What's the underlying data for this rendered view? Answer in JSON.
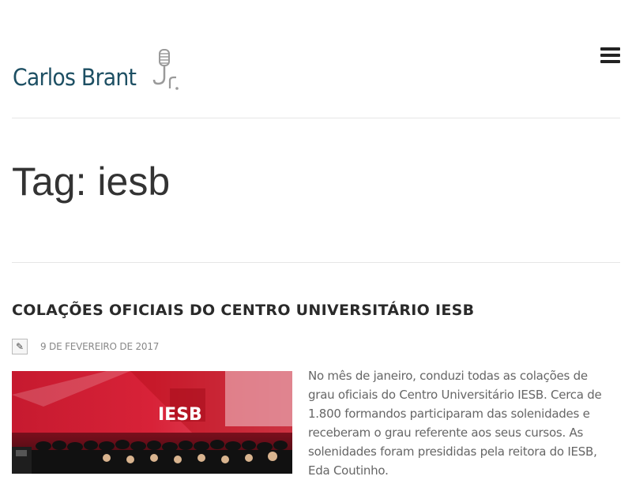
{
  "site": {
    "logo_text": "Carlos Brant",
    "brand_color": "#1d4f63",
    "menu_icon": "hamburger-icon"
  },
  "page": {
    "title": "Tag: iesb"
  },
  "post": {
    "title": "COLAÇÕES OFICIAIS DO CENTRO UNIVERSITÁRIO IESB",
    "edit_icon": "pencil-icon",
    "date": "9 DE FEVEREIRO DE 2017",
    "image_sign_text": "IESB",
    "excerpt": "No mês de janeiro, conduzi todas as colações de grau oficiais do Centro Universitário IESB. Cerca de 1.800 formandos participaram das solenidades e receberam o grau referente aos seus cursos. As solenidades foram presididas pela reitora do IESB, Eda Coutinho."
  }
}
